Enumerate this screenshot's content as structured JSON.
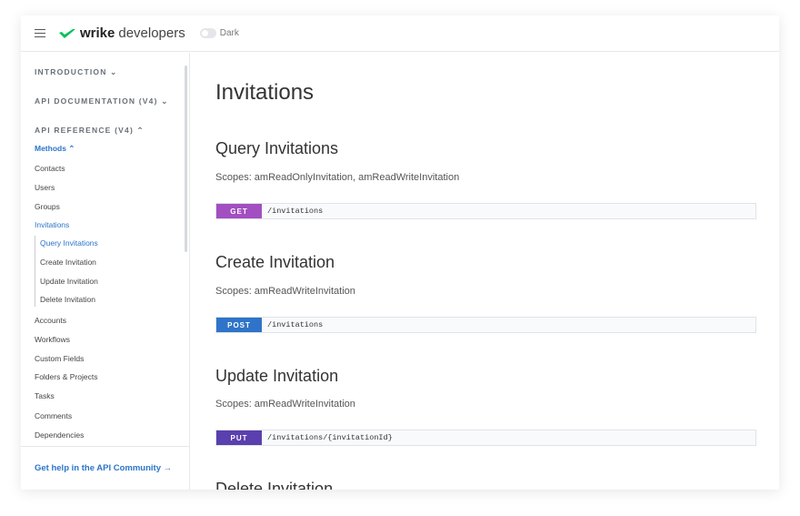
{
  "header": {
    "logo_brand": "wrike",
    "logo_suffix": "developers",
    "theme_toggle_label": "Dark"
  },
  "sidebar": {
    "sections": [
      {
        "label": "INTRODUCTION ⌄"
      },
      {
        "label": "API DOCUMENTATION (V4) ⌄"
      },
      {
        "label": "API REFERENCE (V4) ⌃"
      }
    ],
    "methods_label": "Methods ⌃",
    "items": [
      "Contacts",
      "Users",
      "Groups",
      "Invitations"
    ],
    "subitems": [
      "Query Invitations",
      "Create Invitation",
      "Update Invitation",
      "Delete Invitation"
    ],
    "items_after": [
      "Accounts",
      "Workflows",
      "Custom Fields",
      "Folders & Projects",
      "Tasks",
      "Comments",
      "Dependencies"
    ],
    "help_link": "Get help in the API Community →"
  },
  "main": {
    "title": "Invitations",
    "sections": [
      {
        "title": "Query Invitations",
        "scopes": "Scopes: amReadOnlyInvitation, amReadWriteInvitation",
        "method": "GET",
        "path": "/invitations",
        "color": "#a24fc1"
      },
      {
        "title": "Create Invitation",
        "scopes": "Scopes: amReadWriteInvitation",
        "method": "POST",
        "path": "/invitations",
        "color": "#2f74c8"
      },
      {
        "title": "Update Invitation",
        "scopes": "Scopes: amReadWriteInvitation",
        "method": "PUT",
        "path": "/invitations/{invitationId}",
        "color": "#5a3fae"
      },
      {
        "title": "Delete Invitation"
      }
    ]
  }
}
